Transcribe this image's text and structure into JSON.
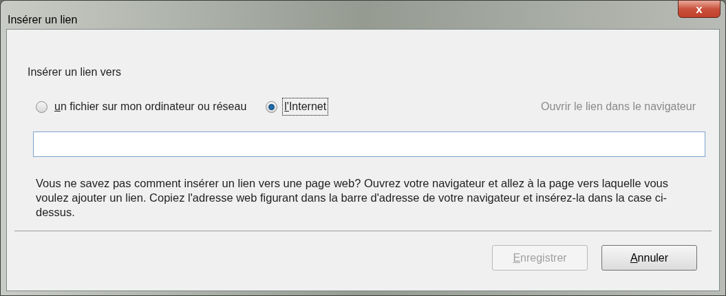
{
  "window": {
    "title": "Insérer un lien",
    "close": "x"
  },
  "group_label": "Insérer un lien vers",
  "radios": [
    {
      "label": "un fichier sur mon ordinateur ou réseau",
      "selected": false,
      "accelerator": true,
      "focused": false
    },
    {
      "label": "l'Internet",
      "selected": true,
      "accelerator": true,
      "focused": true
    }
  ],
  "open_link": {
    "label": "Ouvrir le lien dans le navigateur",
    "disabled": true
  },
  "help": "Vous ne savez pas comment insérer un lien vers une page web? Ouvrez votre navigateur et allez à la page vers laquelle vous voulez ajouter un lien. Copiez l'adresse web figurant dans la barre d'adresse de votre navigateur et insérez-la dans la case ci-dessus.",
  "buttons": [
    {
      "label": "Enregistrer",
      "disabled": true,
      "accelerator": true
    },
    {
      "label": "Annuler",
      "disabled": false,
      "accelerator": true
    }
  ]
}
